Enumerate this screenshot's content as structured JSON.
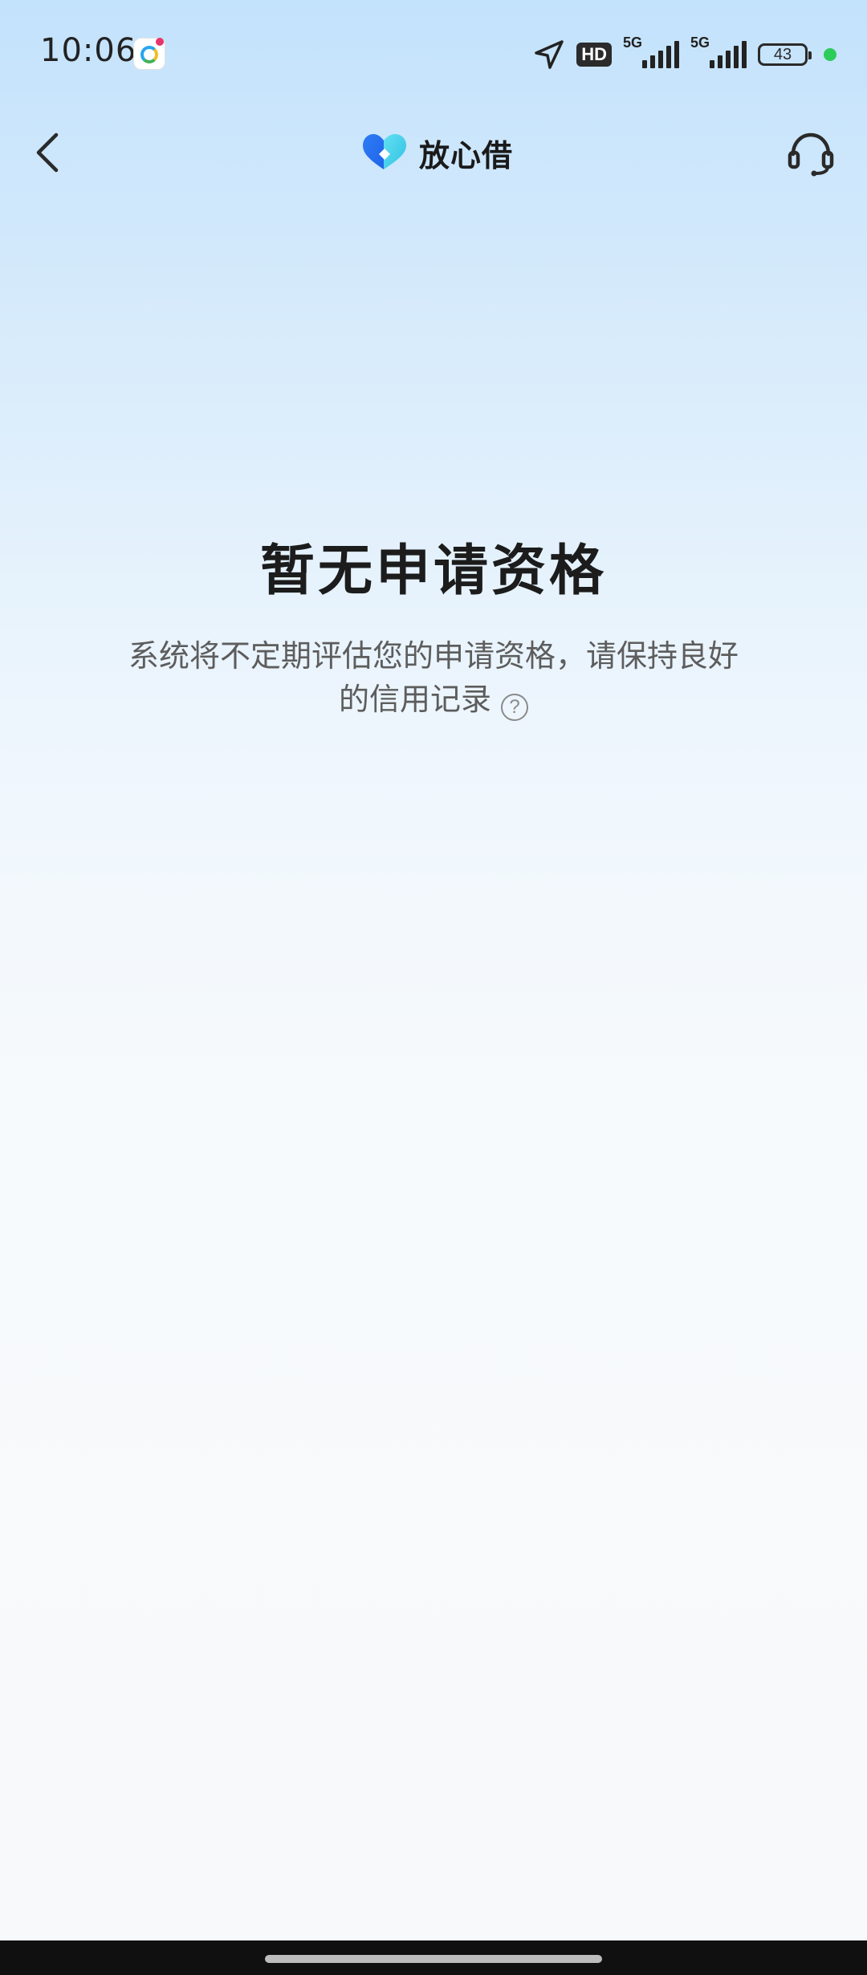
{
  "status_bar": {
    "time": "10:06",
    "hd_label": "HD",
    "signal_1_label": "5G",
    "signal_2_label": "5G",
    "battery_level": "43"
  },
  "header": {
    "brand_name": "放心借",
    "icons": {
      "back": "chevron-left-icon",
      "logo": "heart-logo-icon",
      "support": "headset-icon"
    }
  },
  "main": {
    "title": "暂无申请资格",
    "description": "系统将不定期评估您的申请资格，请保持良好的信用记录",
    "help_glyph": "?"
  },
  "colors": {
    "background_top": "#c3e2fc",
    "background_bottom": "#f8f9fa",
    "title_text": "#1c1c1c",
    "desc_text": "#5d5d5d",
    "logo_blue": "#2f7cf6",
    "logo_cyan": "#3fd0e8"
  }
}
